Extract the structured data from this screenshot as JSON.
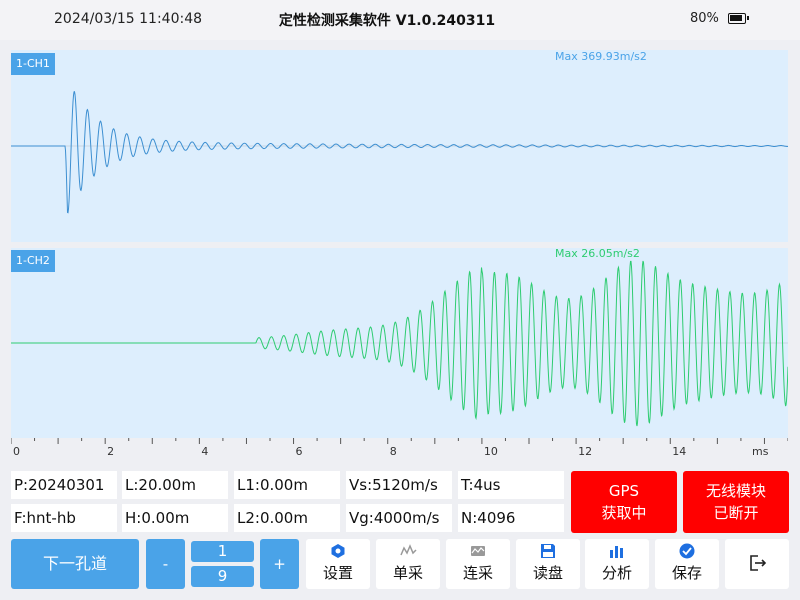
{
  "status": {
    "datetime": "2024/03/15 11:40:48",
    "title": "定性检测采集软件 V1.0.240311",
    "battery": "80%"
  },
  "chart_data": [
    {
      "type": "line",
      "name": "1-CH1",
      "annotation": "Max 369.93m/s2",
      "color": "#3d8fd1",
      "x_unit": "ms",
      "xlim": [
        0,
        16.5
      ],
      "ylim": [
        -400,
        400
      ],
      "x": [
        0,
        1.1,
        1.2,
        1.3,
        1.4,
        1.5,
        1.6,
        1.7,
        1.8,
        1.9,
        2.0,
        2.2,
        2.4,
        2.6,
        3.0,
        4.0,
        6.0,
        10.0,
        16.5
      ],
      "y": [
        0,
        0,
        120,
        -300,
        200,
        -200,
        300,
        -100,
        150,
        -150,
        100,
        -80,
        60,
        -50,
        30,
        20,
        10,
        5,
        0
      ],
      "note": "damped oscillation decaying after ~1.2 ms"
    },
    {
      "type": "line",
      "name": "1-CH2",
      "annotation": "Max 26.05m/s2",
      "color": "#2ecc71",
      "x_unit": "ms",
      "xlim": [
        0,
        16.5
      ],
      "ylim": [
        -28,
        28
      ],
      "x": [
        0,
        5.2,
        5.5,
        6.0,
        7.0,
        8.0,
        9.0,
        10.0,
        10.4,
        11.0,
        11.7,
        12.5,
        13.5,
        14.5,
        15.5,
        16.5
      ],
      "y": [
        0,
        0,
        -3,
        4,
        -8,
        10,
        -14,
        20,
        -26,
        22,
        26,
        20,
        18,
        15,
        12,
        8
      ]
    }
  ],
  "x_axis": {
    "ticks": [
      "0",
      "2",
      "4",
      "6",
      "8",
      "10",
      "12",
      "14"
    ],
    "unit": "ms"
  },
  "info": {
    "p": "P:20240301",
    "l": "L:20.00m",
    "l1": "L1:0.00m",
    "vs": "Vs:5120m/s",
    "t": "T:4us",
    "f": "F:hnt-hb",
    "h": "H:0.00m",
    "l2": "L2:0.00m",
    "vg": "Vg:4000m/s",
    "n": "N:4096"
  },
  "gps": {
    "line1": "GPS",
    "line2": "获取中"
  },
  "wireless": {
    "line1": "无线模块",
    "line2": "已断开"
  },
  "controls": {
    "next_hole": "下一孔道",
    "minus": "-",
    "plus": "+",
    "page_current": "1",
    "page_total": "9"
  },
  "toolbar": {
    "settings": "设置",
    "single": "单采",
    "continuous": "连采",
    "read_disk": "读盘",
    "analyze": "分析",
    "save": "保存"
  },
  "colors": {
    "accent": "#4aa3e8",
    "alert": "#ff0000",
    "chart_bg": "#ddeefd"
  }
}
